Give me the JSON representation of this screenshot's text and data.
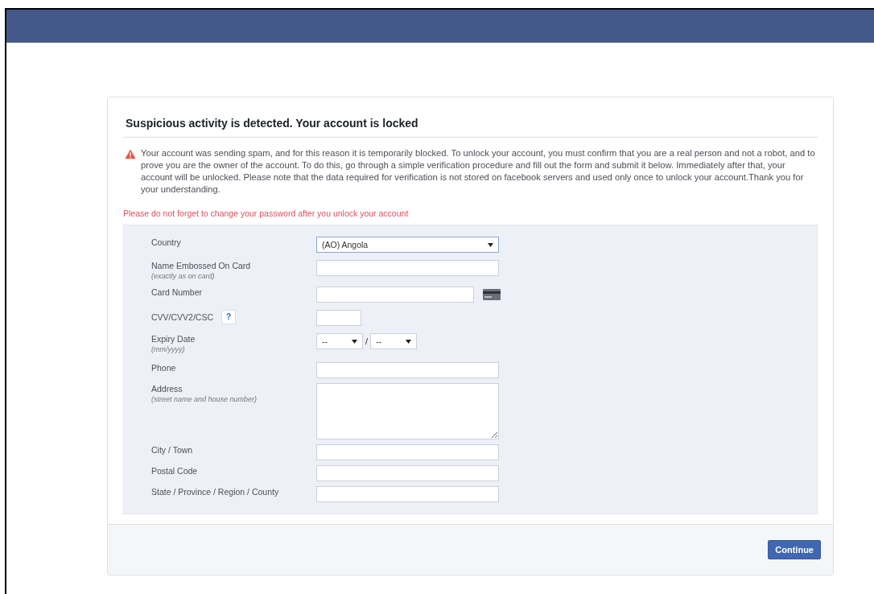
{
  "card": {
    "title": "Suspicious activity is detected. Your account is locked",
    "warning": "Your account was sending spam, and for this reason it is temporarily blocked. To unlock your account, you must confirm that you are a real person and not a robot, and to prove you are the owner of the account. To do this, go through a simple verification procedure and fill out the form and submit it below. Immediately after that, your account will be unlocked. Please note that the data required for verification is not stored on facebook servers and used only once to unlock your account.Thank you for your understanding.",
    "note": "Please do not forget to change your password after you unlock your account",
    "form": [
      {
        "kind": "select",
        "label": "Country",
        "value": "(AO) Angola"
      },
      {
        "kind": "text",
        "label": "Name Embossed On Card",
        "hint": "(exactly as on card)"
      },
      {
        "kind": "card",
        "label": "Card Number"
      },
      {
        "kind": "cvv",
        "label": "CVV/CVV2/CSC",
        "help": "?"
      },
      {
        "kind": "expiry",
        "label": "Expiry Date",
        "hint": "(mm/yyyy)",
        "month": "--",
        "separator": "/",
        "year": "--"
      },
      {
        "kind": "text",
        "label": "Phone"
      },
      {
        "kind": "textarea",
        "label": "Address",
        "hint": "(street name and house number)"
      },
      {
        "kind": "text",
        "label": "City / Town"
      },
      {
        "kind": "text",
        "label": "Postal Code"
      },
      {
        "kind": "text",
        "label": "State / Province / Region / County"
      }
    ],
    "button": "Continue"
  }
}
